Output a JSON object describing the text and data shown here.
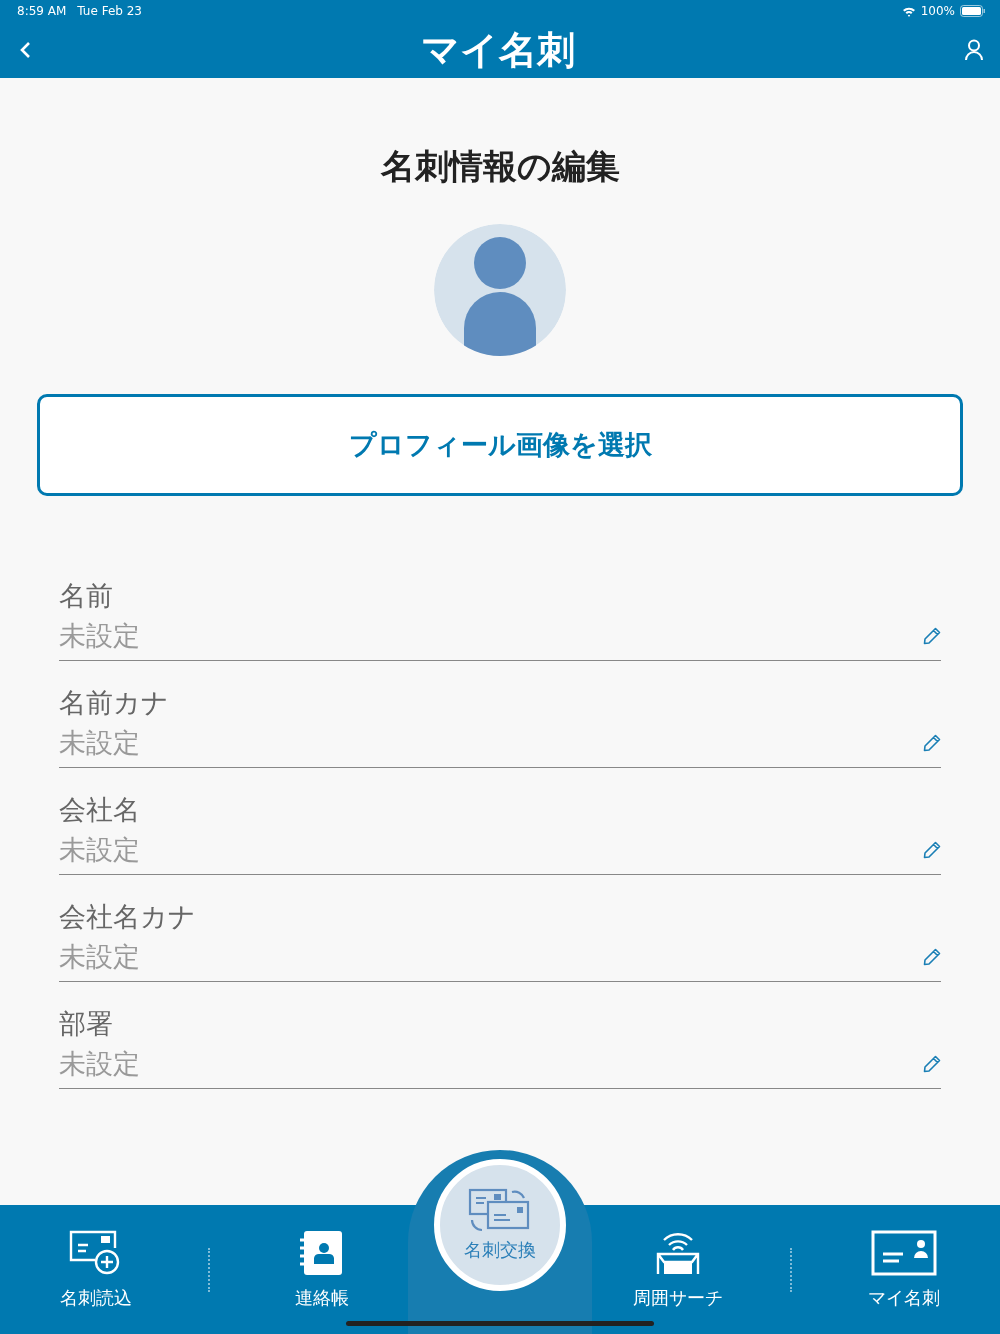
{
  "status_bar": {
    "time": "8:59 AM",
    "date": "Tue Feb 23",
    "battery": "100%"
  },
  "nav_bar": {
    "title": "マイ名刺"
  },
  "page_title": "名刺情報の編集",
  "profile_button": "プロフィール画像を選択",
  "fields": [
    {
      "label": "名前",
      "value": "未設定"
    },
    {
      "label": "名前カナ",
      "value": "未設定"
    },
    {
      "label": "会社名",
      "value": "未設定"
    },
    {
      "label": "会社名カナ",
      "value": "未設定"
    },
    {
      "label": "部署",
      "value": "未設定"
    }
  ],
  "tab_bar": [
    {
      "label": "名刺読込",
      "kind": "scan"
    },
    {
      "label": "連絡帳",
      "kind": "contacts"
    },
    {
      "label": "名刺交換",
      "kind": "exchange"
    },
    {
      "label": "周囲サーチ",
      "kind": "search"
    },
    {
      "label": "マイ名刺",
      "kind": "card"
    }
  ]
}
